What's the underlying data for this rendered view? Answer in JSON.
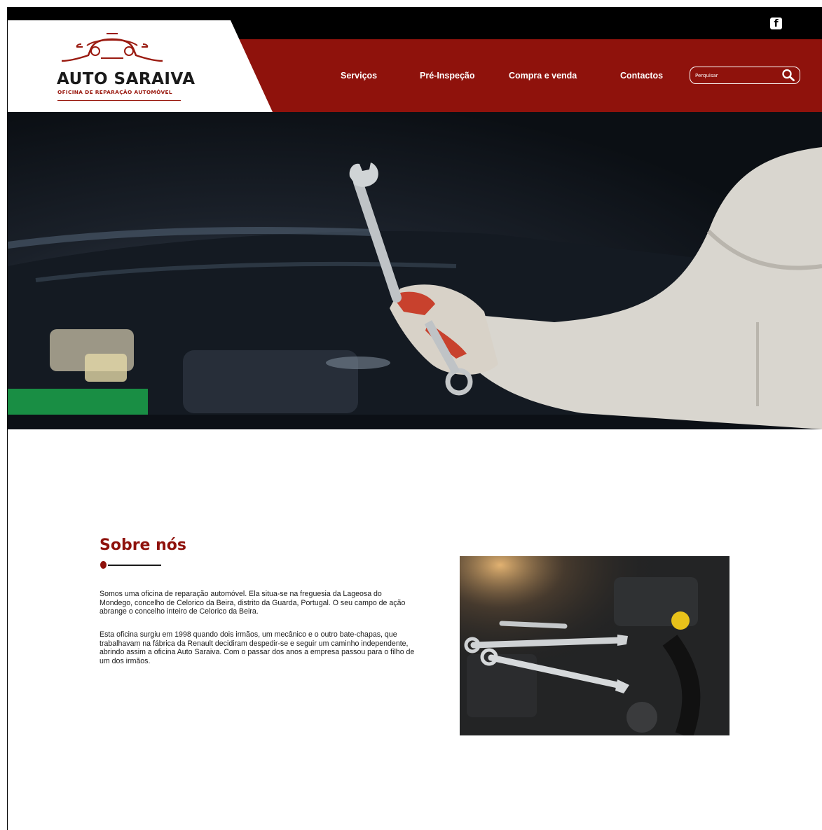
{
  "brand": {
    "name": "AUTO SARAIVA",
    "tagline": "OFICINA DE REPARAÇÃO AUTOMÓVEL"
  },
  "social": {
    "icon": "facebook-icon"
  },
  "nav": {
    "items": [
      {
        "label": "Serviços"
      },
      {
        "label": "Pré-Inspeção"
      },
      {
        "label": "Compra e venda"
      },
      {
        "label": "Contactos"
      }
    ]
  },
  "search": {
    "placeholder": "Perquisar",
    "icon": "search-icon"
  },
  "colors": {
    "brand_red": "#8f120c",
    "topbar": "#000000",
    "text": "#1a1a1a"
  },
  "hero": {
    "image": "mechanic-holding-wrench-photo"
  },
  "about": {
    "title": "Sobre nós",
    "paragraphs": [
      "Somos uma oficina de reparação automóvel. Ela situa-se na freguesia da Lageosa do Mondego, concelho de Celorico da Beira, distrito da Guarda, Portugal. O seu campo de ação abrange o concelho inteiro de Celorico da Beira.",
      "Esta oficina surgiu em 1998 quando dois irmãos, um mecânico e o outro bate-chapas, que trabalhavam na fábrica da Renault decidiram despedir-se e seguir um caminho independente, abrindo assim a oficina Auto Saraiva. Com o passar dos anos a empresa passou para o filho de um dos irmãos."
    ],
    "image": "engine-with-wrenches-photo"
  }
}
